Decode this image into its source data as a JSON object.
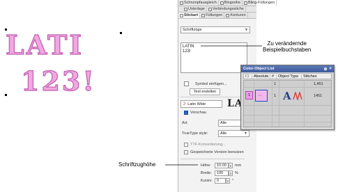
{
  "canvas": {
    "line1": "LATI",
    "line2": "123!",
    "fill_color": "#f0a8e0",
    "stroke_color": "#c05cb0"
  },
  "docker": {
    "tabs_row1": [
      "Schrumpfausgleich",
      "Bingreihe",
      "Bling-Füllungen"
    ],
    "tabs_row2": [
      "Unterlage",
      "Verbindungsstiche"
    ],
    "tabs_row3": [
      "Stickart",
      "Füllungen",
      "Konturen"
    ],
    "type_select": "Schriftzüge",
    "text_value_line1": "LATIN",
    "text_value_line2": "123!",
    "symbol_button": "Symbol einfügen...",
    "create_text_button": "Text erstellen",
    "font_name": "Latin Wide",
    "font_preview": "LA",
    "preview_label": "Vorschau",
    "art_label": "Art:",
    "art_value": "Alle",
    "truetype_label": "TrueType style:",
    "truetype_value": "Alle",
    "ttf_convert_label": "TTF-Konvertierung...",
    "compressed_label": "Gespeicherte Version benutzen",
    "height_label": "Höhe:",
    "height_value": "10.00",
    "height_unit": "mm",
    "width_label": "Breite:",
    "width_value": "100",
    "width_unit": "%",
    "italic_label": "Kursiv:",
    "italic_value": "0",
    "italic_unit": "°"
  },
  "color_list": {
    "title": "Color-Object List",
    "col_blank": "",
    "col_hash": "#",
    "col_object_type": "Object Type",
    "col_stitches": "Stitches",
    "col_first": "Absolute",
    "row1_num": "1",
    "row1_stitches": "1,451",
    "row2_num": "1",
    "row2_stitches": "1451",
    "row2_icon": "A",
    "swatch_label": "1"
  },
  "callouts": {
    "text_sample": "Zu verändernde\nBeispielbuchstaben",
    "text_sample_line1": "Zu verändernde",
    "text_sample_line2": "Beispielbuchstaben",
    "height": "Schriftzughöhe"
  }
}
